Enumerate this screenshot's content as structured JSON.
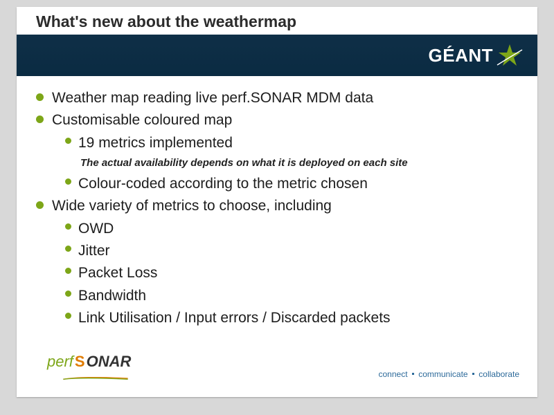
{
  "title": "What's new about the weathermap",
  "brand": "GÉANT",
  "bullets": {
    "b1": "Weather map reading live perf.SONAR MDM data",
    "b2": "Customisable coloured map",
    "b2_1": "19 metrics implemented",
    "note": "The actual availability depends on what it is deployed on each site",
    "b2_2": "Colour-coded according to the metric chosen",
    "b3": "Wide variety of metrics to choose, including",
    "b3_1": "OWD",
    "b3_2": "Jitter",
    "b3_3": "Packet Loss",
    "b3_4": "Bandwidth",
    "b3_5": "Link Utilisation / Input errors / Discarded packets"
  },
  "footer_logo": {
    "perf": "perf",
    "s": "S",
    "onar": "ONAR"
  },
  "tagline": {
    "t1": "connect",
    "t2": "communicate",
    "t3": "collaborate"
  }
}
